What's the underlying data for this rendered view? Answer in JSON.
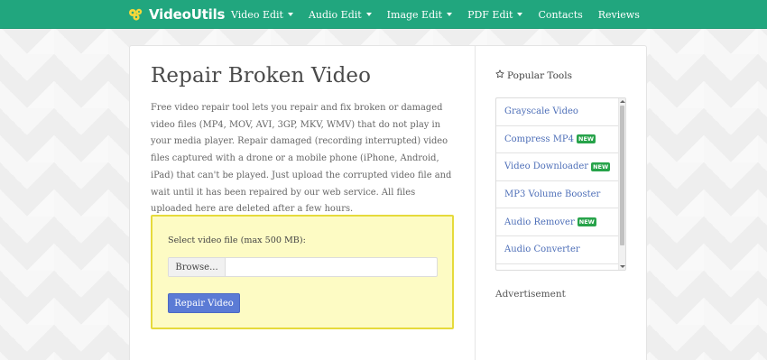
{
  "brand": {
    "name": "VideoUtils",
    "icon": "film-reel-logo-icon"
  },
  "nav": {
    "items": [
      {
        "label": "Video Edit",
        "dropdown": true
      },
      {
        "label": "Audio Edit",
        "dropdown": true
      },
      {
        "label": "Image Edit",
        "dropdown": true
      },
      {
        "label": "PDF Edit",
        "dropdown": true
      },
      {
        "label": "Contacts",
        "dropdown": false
      },
      {
        "label": "Reviews",
        "dropdown": false
      }
    ]
  },
  "main": {
    "title": "Repair Broken Video",
    "description": "Free video repair tool lets you repair and fix broken or damaged video files (MP4, MOV, AVI, 3GP, MKV, WMV) that do not play in your media player. Repair damaged (recording interrupted) video files captured with a drone or a mobile phone (iPhone, Android, iPad) that can't be played. Just upload the corrupted video file and wait until it has been repaired by our web service. All files uploaded here are deleted after a few hours.",
    "upload": {
      "label": "Select video file (max 500 MB):",
      "browse_label": "Browse...",
      "file_value": "",
      "submit_label": "Repair Video"
    }
  },
  "sidebar": {
    "popular_icon": "star-outline-icon",
    "popular_title": "Popular Tools",
    "tools": [
      {
        "label": "Grayscale Video",
        "badge": ""
      },
      {
        "label": "Compress MP4",
        "badge": "NEW"
      },
      {
        "label": "Video Downloader",
        "badge": "NEW"
      },
      {
        "label": "MP3 Volume Booster",
        "badge": ""
      },
      {
        "label": "Audio Remover",
        "badge": "NEW"
      },
      {
        "label": "Audio Converter",
        "badge": ""
      }
    ],
    "ad_label": "Advertisement"
  },
  "colors": {
    "navbar": "#21a67e",
    "upload_bg": "#fdfbc4",
    "upload_border": "#e6da3b",
    "button": "#5b7bd5",
    "link": "#4e6fb8",
    "badge": "#27a34a"
  }
}
